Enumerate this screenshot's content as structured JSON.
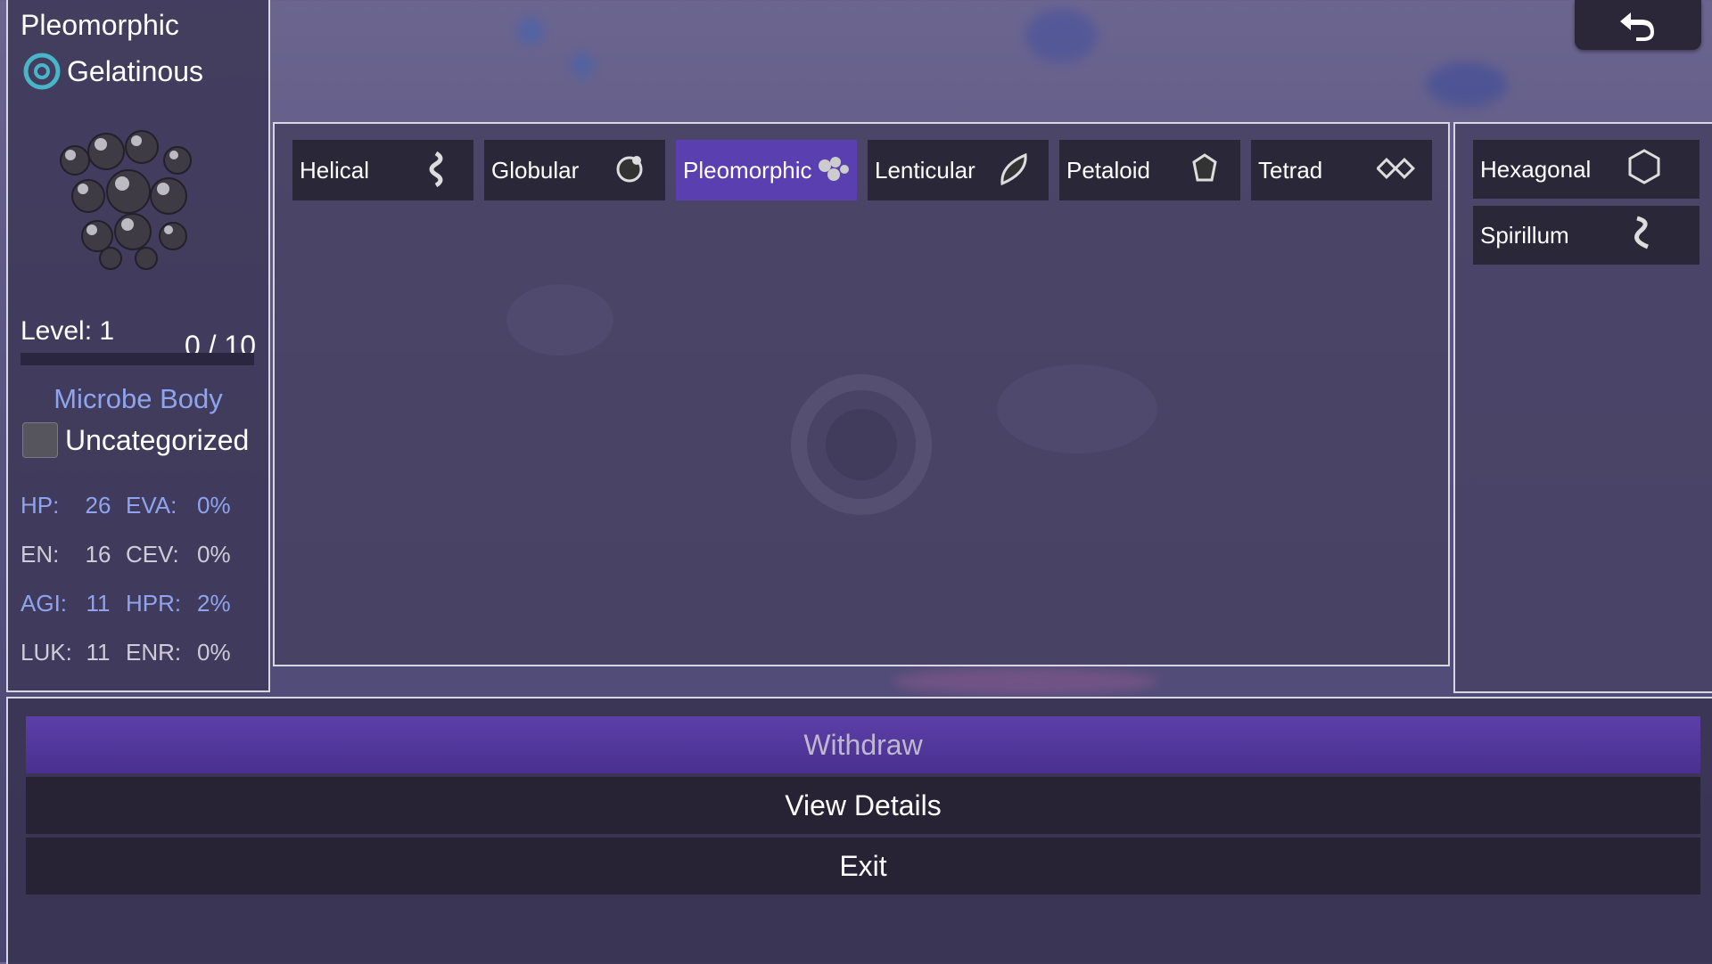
{
  "character": {
    "name": "Pleomorphic",
    "type_label": "Gelatinous",
    "level_label": "Level: 1",
    "xp": "0 / 10",
    "xp_fraction": 0,
    "category_heading": "Microbe Body",
    "category_label": "Uncategorized",
    "stats": [
      {
        "k1": "HP:",
        "v1": "26",
        "k2": "EVA:",
        "v2": "0%",
        "style": "blue"
      },
      {
        "k1": "EN:",
        "v1": "16",
        "k2": "CEV:",
        "v2": "0%",
        "style": "grey"
      },
      {
        "k1": "AGI:",
        "v1": "11",
        "k2": "HPR:",
        "v2": "2%",
        "style": "blue"
      },
      {
        "k1": "LUK:",
        "v1": "11",
        "k2": "ENR:",
        "v2": "0%",
        "style": "grey"
      }
    ]
  },
  "tabs": [
    {
      "label": "Helical",
      "icon": "helical-icon"
    },
    {
      "label": "Globular",
      "icon": "globular-icon"
    },
    {
      "label": "Pleomorphic",
      "icon": "pleomorphic-icon",
      "active": true
    },
    {
      "label": "Lenticular",
      "icon": "lenticular-icon"
    },
    {
      "label": "Petaloid",
      "icon": "petaloid-icon"
    },
    {
      "label": "Tetrad",
      "icon": "tetrad-icon"
    }
  ],
  "side_list": [
    {
      "label": "Hexagonal",
      "icon": "hexagonal-icon"
    },
    {
      "label": "Spirillum",
      "icon": "spirillum-icon"
    }
  ],
  "menu": {
    "withdraw": "Withdraw",
    "view_details": "View Details",
    "exit": "Exit"
  },
  "colors": {
    "accent": "#5a3fb0",
    "stat_blue": "#8fa4ee",
    "tab_bg": "#2a2738"
  }
}
